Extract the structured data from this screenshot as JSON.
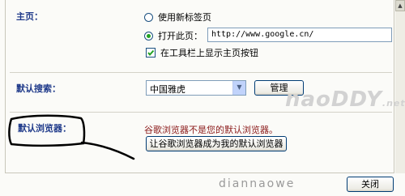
{
  "homepage": {
    "heading": "主页：",
    "option_new_tab": "使用新标签页",
    "option_open_page": "打开此页：",
    "url_value": "http://www.google.cn/",
    "show_home_button": "在工具栏上显示主页按钮",
    "selected_option": "open_page",
    "show_home_button_checked": true
  },
  "search": {
    "heading": "默认搜索：",
    "engine_selected": "中国雅虎",
    "manage_button": "管理"
  },
  "default_browser": {
    "heading": "默认浏览器：",
    "status_text": "谷歌浏览器不是您的默认浏览器。",
    "make_default_button": "让谷歌浏览器成为我的默认浏览器"
  },
  "footer": {
    "close_button": "关闭"
  },
  "watermark": {
    "logo_text": "naoDDY",
    "logo_suffix": ".net",
    "site_text": "diannaowe"
  },
  "colors": {
    "heading": "#1f3a8a",
    "warning": "#8b1a1a",
    "radio_dot": "#21a121",
    "button_border": "#003c74"
  }
}
